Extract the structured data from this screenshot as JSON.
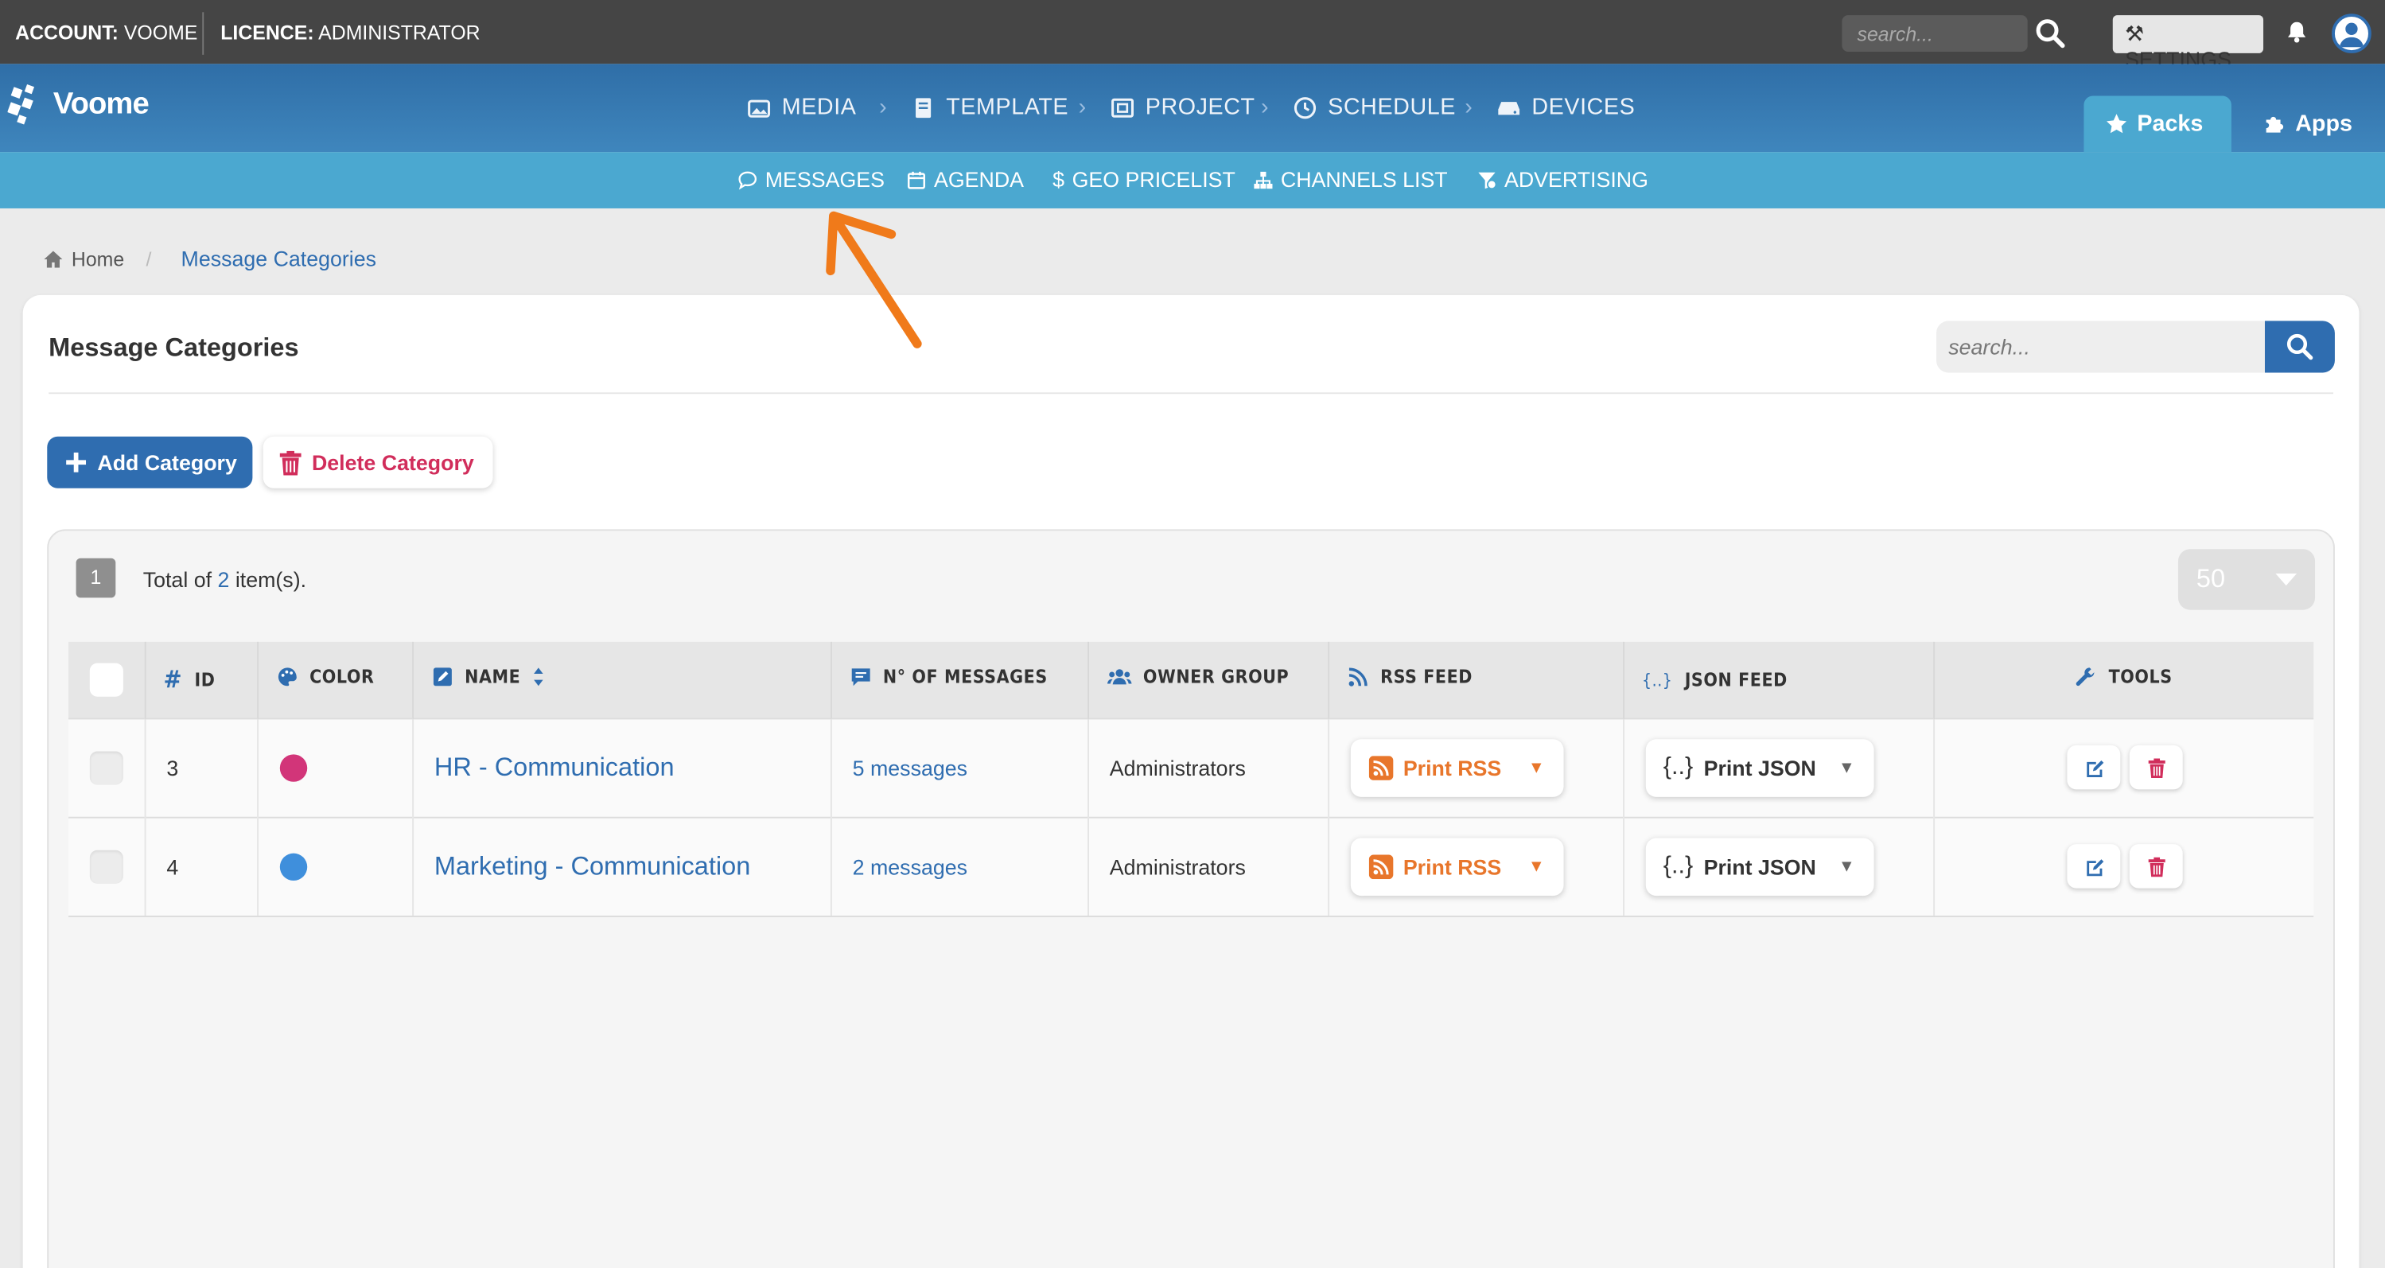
{
  "topbar": {
    "account_label": "ACCOUNT:",
    "account_value": "VOOME",
    "licence_label": "LICENCE:",
    "licence_value": "ADMINISTRATOR",
    "search_placeholder": "search...",
    "settings_label": "SETTINGS"
  },
  "brand": {
    "name": "Voome"
  },
  "nav": {
    "main": [
      "MEDIA",
      "TEMPLATE",
      "PROJECT",
      "SCHEDULE",
      "DEVICES"
    ],
    "packs_label": "Packs",
    "apps_label": "Apps",
    "sub": [
      "MESSAGES",
      "AGENDA",
      "GEO PRICELIST",
      "CHANNELS LIST",
      "ADVERTISING"
    ]
  },
  "breadcrumb": {
    "home": "Home",
    "current": "Message Categories"
  },
  "page": {
    "title": "Message Categories",
    "search_placeholder": "search...",
    "add_label": "Add Category",
    "delete_label": "Delete Category"
  },
  "table": {
    "page_number": "1",
    "total_prefix": "Total of",
    "total_count": "2",
    "total_suffix": "item(s).",
    "per_page": "50",
    "columns": [
      "ID",
      "COLOR",
      "NAME",
      "N° OF MESSAGES",
      "OWNER GROUP",
      "RSS FEED",
      "JSON FEED",
      "TOOLS"
    ],
    "rows": [
      {
        "id": "3",
        "color": "#d23579",
        "name": "HR - Communication",
        "messages": "5 messages",
        "owner": "Administrators",
        "rss": "Print RSS",
        "json": "Print JSON"
      },
      {
        "id": "4",
        "color": "#3f8fdc",
        "name": "Marketing - Communication",
        "messages": "2 messages",
        "owner": "Administrators",
        "rss": "Print RSS",
        "json": "Print JSON"
      }
    ]
  },
  "colors": {
    "primary": "#2f6db0",
    "subnav": "#4ba8d0",
    "danger": "#d12d5b",
    "rss": "#e8762b",
    "annotation": "#f07a1a"
  }
}
